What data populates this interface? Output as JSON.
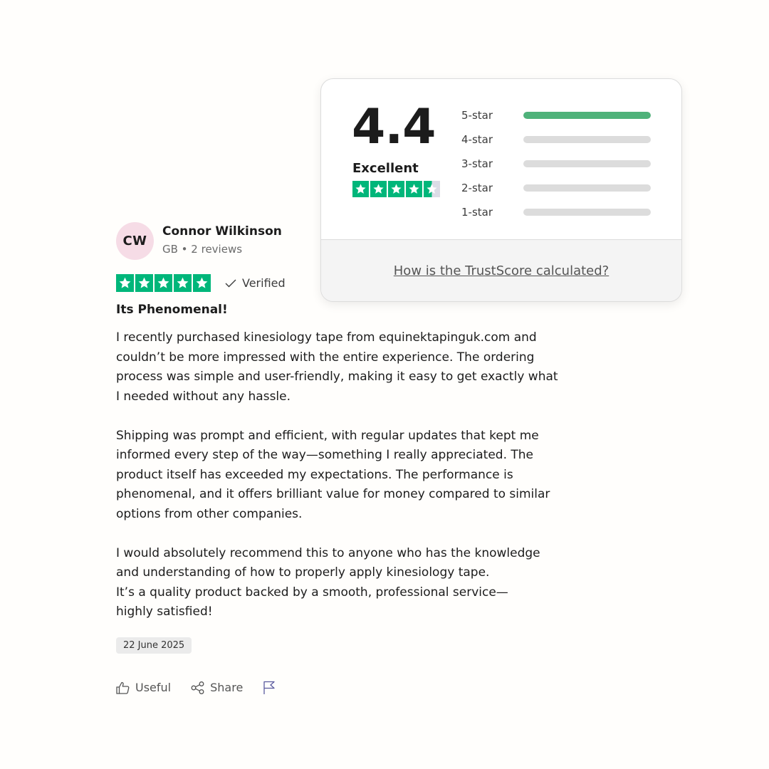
{
  "reviewer": {
    "initials": "CW",
    "name": "Connor Wilkinson",
    "meta": "GB • 2 reviews"
  },
  "review": {
    "rating": 5,
    "verified_label": "Verified",
    "title": "Its Phenomenal!",
    "paragraphs": [
      "I recently purchased kinesiology tape from equinektapinguk.com and\ncouldn’t be more impressed with the entire experience. The ordering\nprocess was simple and user-friendly, making it easy to get exactly what\nI needed without any hassle.",
      "Shipping was prompt and efficient, with regular updates that kept me\ninformed every step of the way—something I really appreciated. The\nproduct itself has exceeded my expectations. The performance is\nphenomenal, and it offers brilliant value for money compared to similar\noptions from other companies.",
      "I would absolutely recommend this to anyone who has the knowledge\nand understanding of how to properly apply kinesiology tape.\nIt’s a quality product backed by a smooth, professional service—\nhighly satisfied!"
    ],
    "date": "22 June 2025"
  },
  "actions": {
    "useful_label": "Useful",
    "share_label": "Share",
    "useful_icon": "thumbs-up-icon",
    "share_icon": "share-icon",
    "report_icon": "flag-icon"
  },
  "trustscore": {
    "score": "4.4",
    "label": "Excellent",
    "stars": 4.5,
    "distribution": [
      {
        "label": "5-star",
        "fill": 1.0
      },
      {
        "label": "4-star",
        "fill": 0
      },
      {
        "label": "3-star",
        "fill": 0
      },
      {
        "label": "2-star",
        "fill": 0
      },
      {
        "label": "1-star",
        "fill": 0
      }
    ],
    "link_text": "How is the TrustScore calculated?"
  },
  "colors": {
    "star_green": "#00b67a",
    "bar_green": "#4fb27a",
    "avatar_bg": "#f6dce6"
  }
}
